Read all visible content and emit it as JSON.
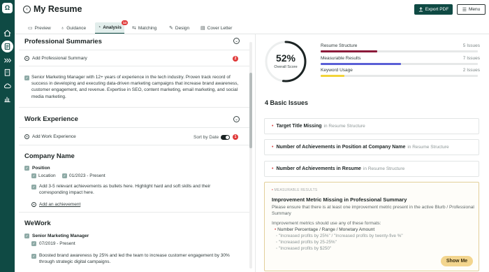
{
  "app": {
    "logo_text": "Ω",
    "title": "My Resume",
    "export_label": "Export PDF",
    "menu_label": "Menu"
  },
  "sidebar": {
    "items": [
      {
        "icon": "home-icon"
      },
      {
        "icon": "resume-icon",
        "active": true
      },
      {
        "icon": "chevrons-right-icon"
      },
      {
        "icon": "building-icon"
      },
      {
        "icon": "cloud-icon"
      },
      {
        "icon": "chart-icon"
      }
    ]
  },
  "tabs": [
    {
      "label": "Preview",
      "icon": "preview-icon"
    },
    {
      "label": "Guidance",
      "icon": "lightbulb-icon"
    },
    {
      "label": "Analysis",
      "icon": "analysis-icon",
      "active": true,
      "badge": "14"
    },
    {
      "label": "Matching",
      "icon": "matching-icon"
    },
    {
      "label": "Design",
      "icon": "pencil-icon"
    },
    {
      "label": "Cover Letter",
      "icon": "letter-icon"
    }
  ],
  "editor": {
    "summary": {
      "title": "Professional Summaries",
      "add_label": "Add Professional Summary",
      "badge": "2",
      "text": "Senior Marketing Manager with 12+ years of experience in the tech industry. Proven track record of success in developing and executing data-driven marketing campaigns that increase brand awareness, customer engagement, and revenue. Expertise in SEO, content marketing, email marketing, and social media marketing."
    },
    "work": {
      "title": "Work Experience",
      "add_label": "Add Work Experience",
      "sort_label": "Sort by Date",
      "badge": "1"
    },
    "company1": {
      "title": "Company Name",
      "position": "Position",
      "location": "Location",
      "dates": "01/2023 - Present",
      "bullet_hint": "Add 3-5 relevant achievements as bullets here. Highlight hard and soft skills and their corresponding impact here.",
      "add_achievement": "Add an achievement"
    },
    "company2": {
      "title": "WeWork",
      "position": "Senior Marketing Manager",
      "dates": "07/2019 - Present",
      "bullet": "Boosted brand awareness by 25% and led the team to increase customer engagement by 30% through strategic digital campaigns."
    }
  },
  "analysis": {
    "overall_value": "52%",
    "overall_label": "Overall Score",
    "overall_fraction": 0.52,
    "metrics": [
      {
        "name": "Resume Structure",
        "count": "5 Issues",
        "fill": 0.36,
        "color": "#8b1a3a"
      },
      {
        "name": "Measurable Results",
        "count": "7 Issues",
        "fill": 0.51,
        "color": "#5a5fd6"
      },
      {
        "name": "Keyword Usage",
        "count": "2 Issues",
        "fill": 0.15,
        "color": "#f2d43a"
      }
    ],
    "issues_title": "4 Basic Issues",
    "issues": [
      {
        "bold": "Target Title Missing",
        "category": "in Resume Structure"
      },
      {
        "bold": "Number of Achievements in Position at Company Name",
        "category": "in Resume Structure"
      },
      {
        "bold": "Number of Achievements in Resume",
        "category": "in Resume Structure"
      }
    ],
    "detail": {
      "tag": "MEASURABLE RESULTS",
      "title": "Improvement Metric Missing in Professional Summary",
      "description": "Please ensure that there is at least one improvement metric present in the active Blurb / Professional Summary",
      "formats_intro": "Improvement metrics should use any of these formats:",
      "format_bullet": "Number Percentage / Range / Monetary Amount",
      "examples": [
        "\"Increased profits by 25%\" / \"Increased profits by twenty-five %\"",
        "\"Increased profits by 25-25%\"",
        "\"Increased profits by $250\""
      ],
      "button": "Show Me"
    }
  }
}
